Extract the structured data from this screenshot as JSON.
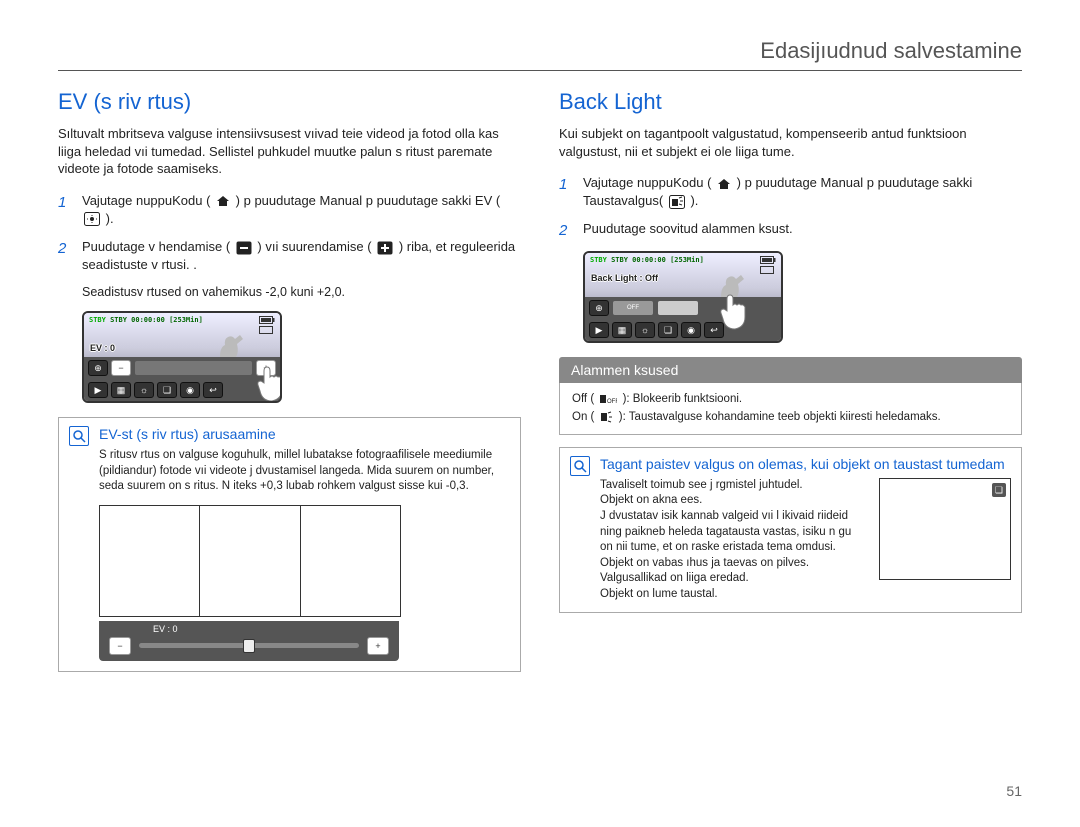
{
  "header": {
    "title": "Edasijıudnud salvestamine"
  },
  "page_number": "51",
  "left": {
    "title": "EV (s riv rtus)",
    "intro": "Sıltuvalt mbritseva valguse intensiivsusest vıivad teie videod ja fotod olla kas liiga heledad vıi tumedad. Sellistel puhkudel muutke palun s ritust paremate videote ja fotode saamiseks.",
    "steps": [
      {
        "n": "1",
        "text_a": "Vajutage nuppuKodu (",
        "text_b": ") p puudutage Manual p puudutage sakki EV (",
        "text_c": ")."
      },
      {
        "n": "2",
        "text_a": "Puudutage v hendamise (",
        "text_b": ") vıi suurendamise (",
        "text_c": ") riba, et reguleerida seadistuste v rtusi. ."
      }
    ],
    "note": "Seadistusv rtused on vahemikus -2,0 kuni +2,0.",
    "lcd": {
      "status": "STBY 00:00:00 [253Min]",
      "ev_label": "EV : 0",
      "minus": "−",
      "plus": "+"
    },
    "info": {
      "title": "EV-st (s riv rtus) arusaamine",
      "body": "S ritusv rtus on valguse koguhulk, millel lubatakse fotograafilisele meediumile (pildiandur) fotode vıi videote j dvustamisel langeda. Mida suurem on number, seda suurem on s ritus. N iteks +0,3 lubab rohkem valgust sisse kui -0,3.",
      "ev_label": "EV : 0",
      "minus": "−",
      "plus": "+"
    }
  },
  "right": {
    "title": "Back Light",
    "intro": "Kui subjekt on tagantpoolt valgustatud, kompenseerib antud funktsioon valgustust, nii et subjekt ei ole liiga tume.",
    "steps": [
      {
        "n": "1",
        "text_a": "Vajutage nuppuKodu (",
        "text_b": ") p puudutage Manual p puudutage sakki Taustavalgus(",
        "text_c": ")."
      },
      {
        "n": "2",
        "text_a": "Puudutage soovitud alammen ksust."
      }
    ],
    "lcd": {
      "status": "STBY 00:00:00 [253Min]",
      "overlay": "Back Light : Off",
      "off_btn": "OFF"
    },
    "options": {
      "header": "Alammen ksused",
      "off": "Off (",
      "off_tail": "): Blokeerib funktsiooni.",
      "on": "On (",
      "on_tail": "): Taustavalguse kohandamine teeb objekti kiiresti heledamaks."
    },
    "info": {
      "title": "Tagant paistev valgus on olemas, kui objekt on taustast tumedam",
      "body": "Tavaliselt toimub see j rgmistel juhtudel.\nObjekt on akna ees.\nJ dvustatav isik kannab valgeid vıi l ikivaid riideid ning paikneb heleda tagatausta vastas, isiku n gu on nii tume, et on raske eristada tema omdusi.\nObjekt on vabas ıhus ja taevas on pilves.\nValgusallikad on liiga eredad.\nObjekt on lume taustal."
    }
  }
}
